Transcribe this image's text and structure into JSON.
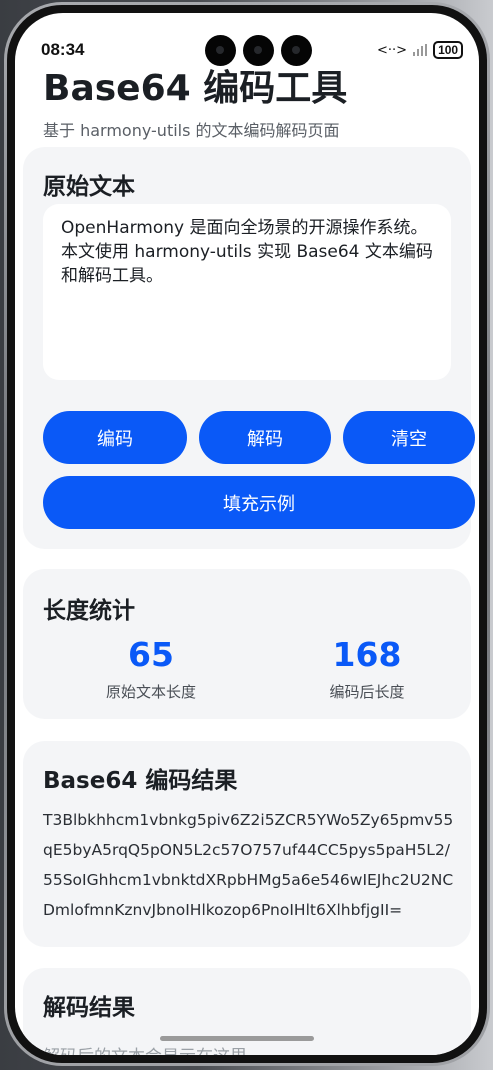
{
  "status_bar": {
    "time": "08:34",
    "battery": "100"
  },
  "page": {
    "title": "Base64 编码工具",
    "subtitle": "基于 harmony-utils 的文本编码解码页面"
  },
  "input_card": {
    "heading": "原始文本",
    "text": "OpenHarmony 是面向全场景的开源操作系统。本文使用 harmony-utils 实现 Base64 文本编码和解码工具。",
    "buttons": {
      "encode": "编码",
      "decode": "解码",
      "clear": "清空",
      "fill_example": "填充示例"
    }
  },
  "stats_card": {
    "heading": "长度统计",
    "original_length": "65",
    "original_label": "原始文本长度",
    "encoded_length": "168",
    "encoded_label": "编码后长度"
  },
  "encode_card": {
    "heading": "Base64 编码结果",
    "result": "T3Blbkhhcm1vbnkg5piv6Z2i5ZCR5YWo5Zy65pmv55qE5byA5rqQ5pON5L2c57O757uf44CC5pys5paH5L2/55SoIGhhcm1vbnktdXRpbHMg5a6e546wIEJhc2U2NCDmlofmnKznvJbnoIHlkozop6PnoIHlt6XlhbfjgII="
  },
  "decode_card": {
    "heading": "解码结果",
    "placeholder": "解码后的文本会显示在这里"
  },
  "colors": {
    "accent": "#0a59f7",
    "card_bg": "#f4f5f7",
    "title": "#1b1f24"
  }
}
